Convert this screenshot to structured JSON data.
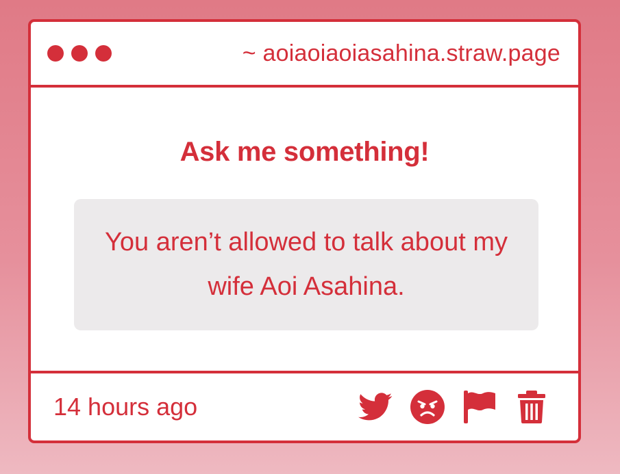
{
  "window": {
    "url": "~ aoiaoiaoiasahina.straw.page"
  },
  "main": {
    "heading": "Ask me something!",
    "question": "You aren’t allowed to talk about my wife Aoi Asahina."
  },
  "footer": {
    "timestamp": "14 hours ago",
    "actions": [
      {
        "icon": "twitter-icon"
      },
      {
        "icon": "angry-face-icon"
      },
      {
        "icon": "flag-icon"
      },
      {
        "icon": "trash-icon"
      }
    ]
  },
  "colors": {
    "accent": "#d42f3a",
    "question_bg": "#eceaeb",
    "background_top": "#e07a86",
    "background_bottom": "#eeb9c1"
  }
}
